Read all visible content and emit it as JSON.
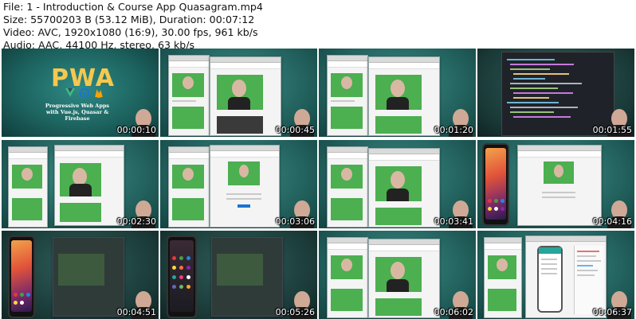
{
  "header": {
    "file_line": "File: 1 - Introduction & Course App Quasagram.mp4",
    "size_line": "Size: 55700203 B (53.12 MiB), Duration: 00:07:12",
    "video_line": "Video: AVC, 1920x1080 (16:9), 30.00 fps, 961 kb/s",
    "audio_line": "Audio: AAC, 44100 Hz, stereo, 63 kb/s"
  },
  "title_slide": {
    "logo_text": "PWA",
    "subtitle_1": "Progressive Web Apps",
    "subtitle_2": "with Vue.js, Quasar & Firebase"
  },
  "thumbnails": [
    {
      "time": "00:00:10",
      "kind": "title"
    },
    {
      "time": "00:00:45",
      "kind": "browser-phone"
    },
    {
      "time": "00:01:20",
      "kind": "browser-phone"
    },
    {
      "time": "00:01:55",
      "kind": "code-editor"
    },
    {
      "time": "00:02:30",
      "kind": "browser-phone"
    },
    {
      "time": "00:03:06",
      "kind": "browser-single"
    },
    {
      "time": "00:03:41",
      "kind": "browser-phone"
    },
    {
      "time": "00:04:16",
      "kind": "android-browser"
    },
    {
      "time": "00:04:51",
      "kind": "android-dark"
    },
    {
      "time": "00:05:26",
      "kind": "android-dark"
    },
    {
      "time": "00:06:02",
      "kind": "browser-phone"
    },
    {
      "time": "00:06:37",
      "kind": "devtools"
    }
  ],
  "colors": {
    "background_teal": "#23625e",
    "logo_gold": "#f6c84e",
    "post_green": "#4caf50"
  }
}
